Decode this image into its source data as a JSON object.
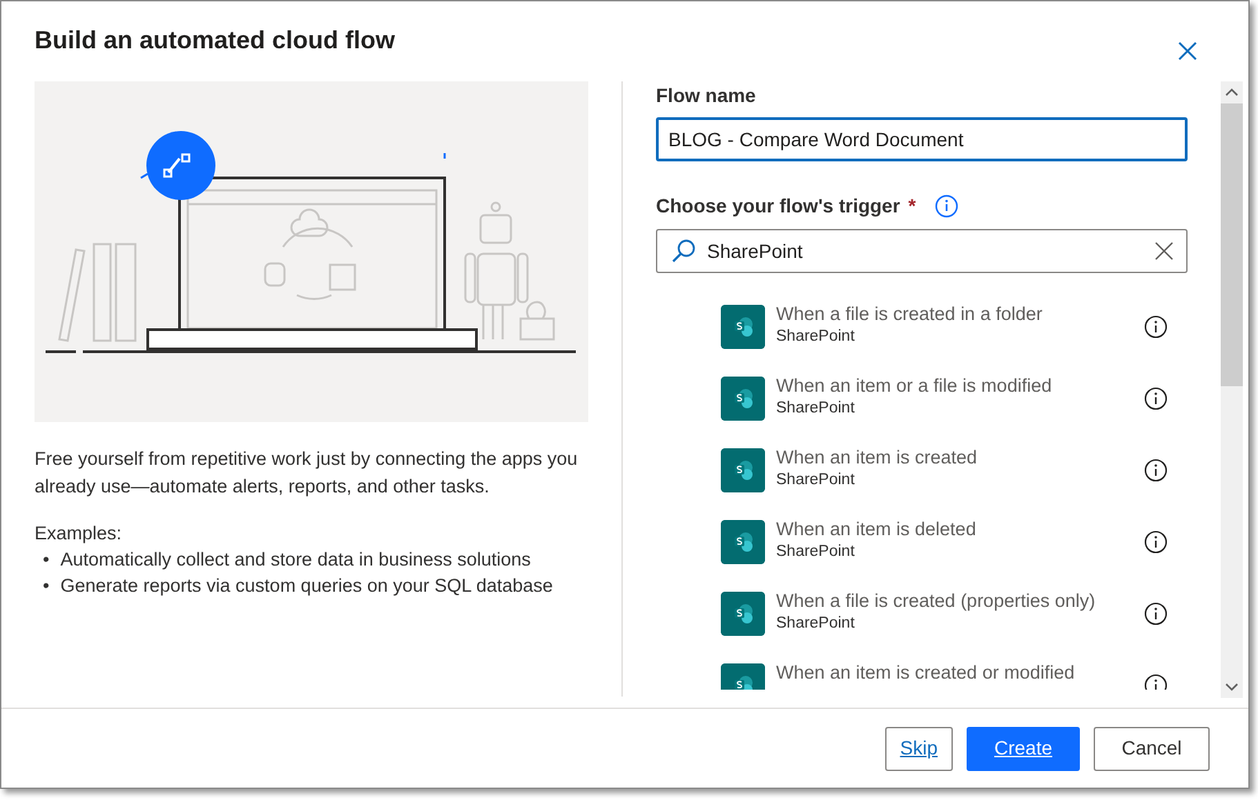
{
  "dialog": {
    "title": "Build an automated cloud flow"
  },
  "intro": {
    "description": "Free yourself from repetitive work just by connecting the apps you already use—automate alerts, reports, and other tasks.",
    "examples_label": "Examples:",
    "examples": [
      {
        "bullet": "•",
        "text": "Automatically collect and store data in business solutions"
      },
      {
        "bullet": "•",
        "text": "Generate reports via custom queries on your SQL database"
      }
    ]
  },
  "flow_name": {
    "label": "Flow name",
    "value": "BLOG - Compare Word Document"
  },
  "trigger": {
    "label": "Choose your flow's trigger",
    "required_mark": "*",
    "search_value": "SharePoint"
  },
  "triggers": [
    {
      "title": "When a file is created in a folder",
      "connector": "SharePoint"
    },
    {
      "title": "When an item or a file is modified",
      "connector": "SharePoint"
    },
    {
      "title": "When an item is created",
      "connector": "SharePoint"
    },
    {
      "title": "When an item is deleted",
      "connector": "SharePoint"
    },
    {
      "title": "When a file is created (properties only)",
      "connector": "SharePoint"
    },
    {
      "title": "When an item is created or modified"
    }
  ],
  "buttons": [
    {
      "label": "Skip",
      "kind": "link"
    },
    {
      "label": "Create",
      "kind": "primary"
    },
    {
      "label": "Cancel",
      "kind": "secondary"
    }
  ]
}
